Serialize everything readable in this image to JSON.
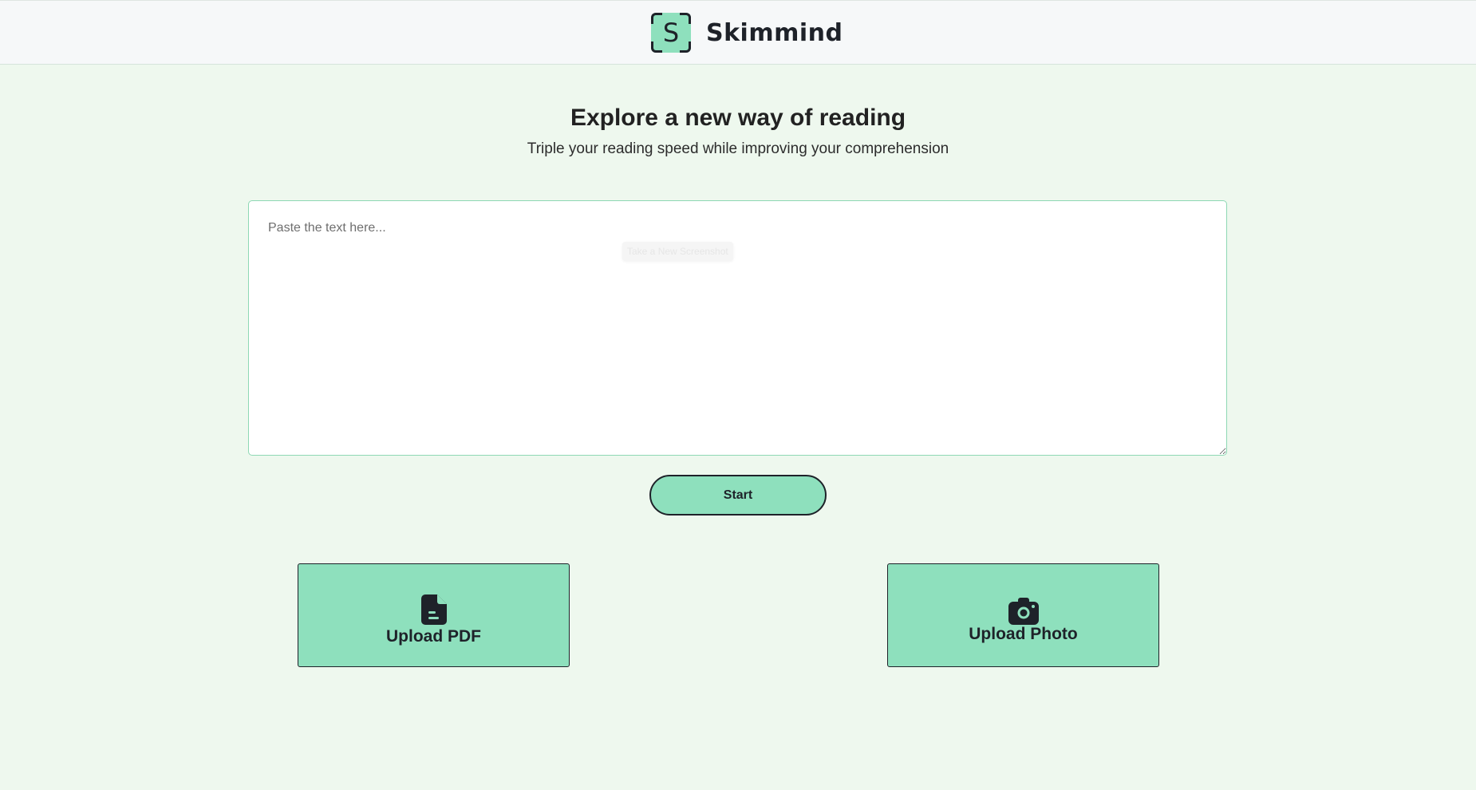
{
  "header": {
    "logo_letter": "S",
    "brand_name": "Skimmind"
  },
  "hero": {
    "title": "Explore a new way of reading",
    "subtitle": "Triple your reading speed while improving your comprehension"
  },
  "text_input": {
    "placeholder": "Paste the text here...",
    "value": ""
  },
  "overlay": {
    "screenshot_tooltip": "Take a New Screenshot"
  },
  "actions": {
    "start_label": "Start",
    "upload_pdf_label": "Upload PDF",
    "upload_pdf_icon": "file-icon",
    "upload_photo_label": "Upload Photo",
    "upload_photo_icon": "camera-icon"
  },
  "colors": {
    "page_background": "#eef8ee",
    "header_background": "#f6f8f9",
    "accent": "#8ee0bd",
    "dark": "#1e2229"
  }
}
